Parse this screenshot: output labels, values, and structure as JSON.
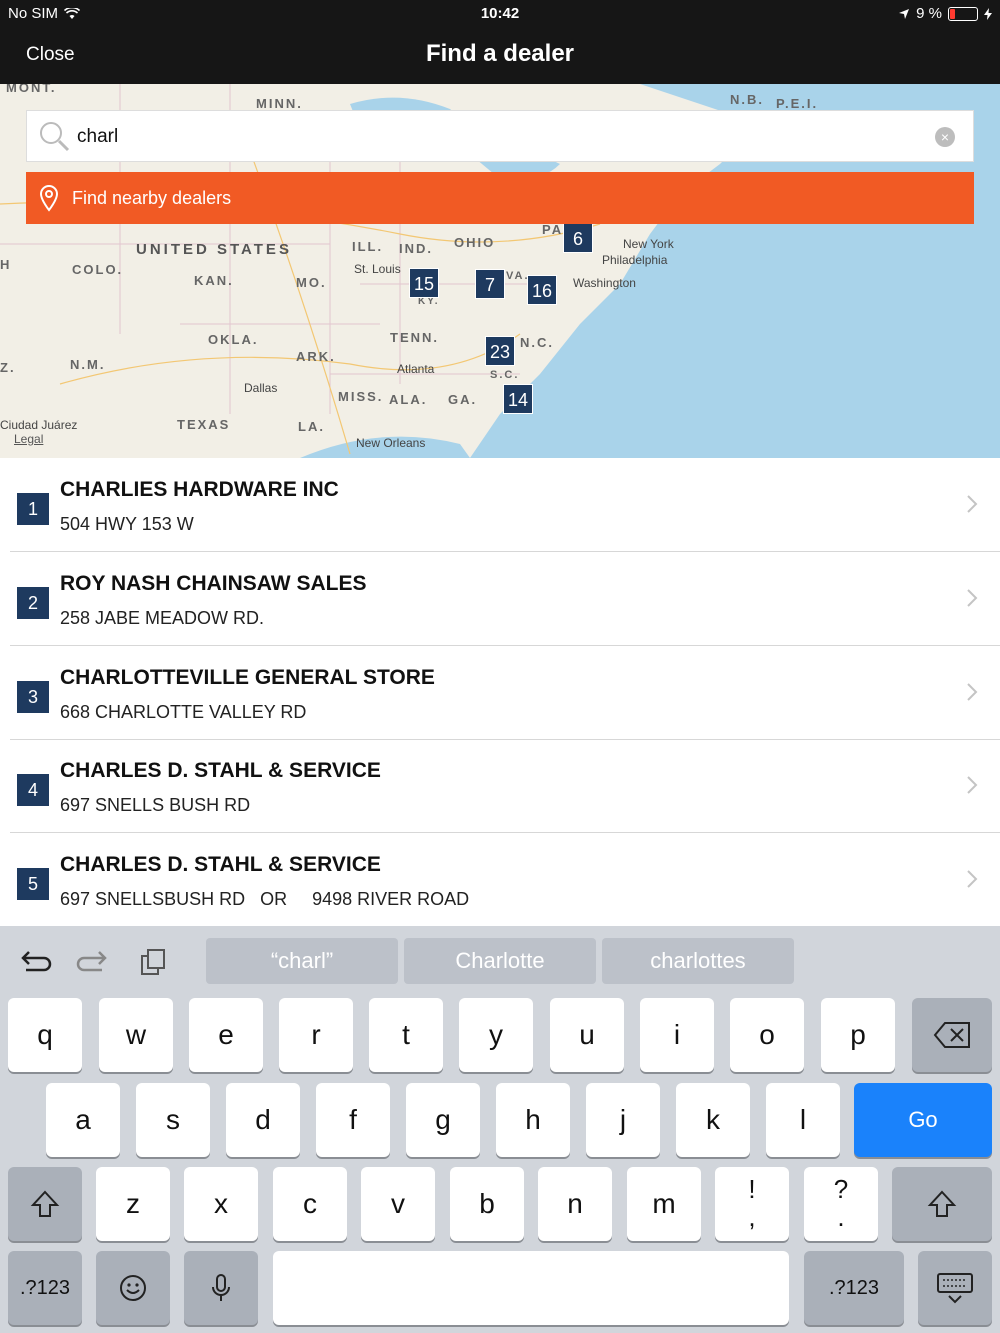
{
  "status_bar": {
    "carrier": "No SIM",
    "time": "10:42",
    "battery": "9 %"
  },
  "nav": {
    "close_label": "Close",
    "title": "Find a dealer"
  },
  "map": {
    "regions": [
      "MONT.",
      "MINN.",
      "N.B.",
      "P.E.I.",
      "UNITED STATES",
      "ILL.",
      "IND.",
      "OHIO",
      "PA",
      "COLO.",
      "KAN.",
      "MO.",
      "KY.",
      "VA.",
      "OKLA.",
      "ARK.",
      "TENN.",
      "N.C.",
      "N.M.",
      "S.C.",
      "MISS.",
      "ALA.",
      "GA.",
      "TEXAS",
      "LA.",
      "H",
      "Z."
    ],
    "cities": [
      "St. Louis",
      "New York",
      "Philadelphia",
      "Washington",
      "Atlanta",
      "Dallas",
      "Ciudad Juárez",
      "New Orleans"
    ],
    "markers": [
      "6",
      "15",
      "7",
      "16",
      "23",
      "14"
    ],
    "legal": "Legal"
  },
  "search": {
    "value": "charl",
    "nearby_label": "Find nearby dealers"
  },
  "dealers": [
    {
      "num": "1",
      "name": "CHARLIES HARDWARE INC",
      "address": "504 HWY 153 W"
    },
    {
      "num": "2",
      "name": "ROY NASH CHAINSAW SALES",
      "address": "258 JABE MEADOW RD."
    },
    {
      "num": "3",
      "name": "CHARLOTTEVILLE GENERAL STORE",
      "address": "668 CHARLOTTE VALLEY RD"
    },
    {
      "num": "4",
      "name": "CHARLES D. STAHL & SERVICE",
      "address": "697 SNELLS BUSH RD"
    },
    {
      "num": "5",
      "name": "CHARLES D. STAHL & SERVICE",
      "address": "697 SNELLSBUSH RD   OR     9498 RIVER ROAD"
    }
  ],
  "keyboard": {
    "suggestions": [
      "“charl”",
      "Charlotte",
      "charlottes"
    ],
    "row1": [
      "q",
      "w",
      "e",
      "r",
      "t",
      "y",
      "u",
      "i",
      "o",
      "p"
    ],
    "row2": [
      "a",
      "s",
      "d",
      "f",
      "g",
      "h",
      "j",
      "k",
      "l"
    ],
    "go": "Go",
    "row3": [
      "z",
      "x",
      "c",
      "v",
      "b",
      "n",
      "m"
    ],
    "punct1_top": "!",
    "punct1_bottom": ",",
    "punct2_top": "?",
    "punct2_bottom": ".",
    "numbers": ".?123"
  },
  "colors": {
    "accent": "#f15a24",
    "marker": "#1e3a5f",
    "go_key": "#1a82fb"
  }
}
